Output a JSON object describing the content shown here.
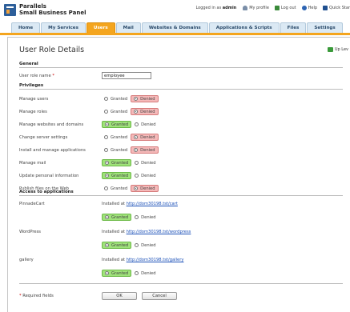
{
  "brand": {
    "line1": "Parallels",
    "line2": "Small Business Panel"
  },
  "header": {
    "login_prefix": "Logged in as",
    "login_user": "admin",
    "my_profile": "My profile",
    "log_out": "Log out",
    "help": "Help",
    "quick_start": "Quick Star"
  },
  "tabs": [
    "Home",
    "My Services",
    "Users",
    "Mail",
    "Websites & Domains",
    "Applications & Scripts",
    "Files",
    "Settings"
  ],
  "active_tab": "Users",
  "page": {
    "title": "User Role Details",
    "up_level": "Up Lev"
  },
  "general": {
    "heading": "General",
    "role_label": "User role name",
    "required_mark": "*",
    "role_value": "employee"
  },
  "privileges": {
    "heading": "Privileges",
    "granted_label": "Granted",
    "denied_label": "Denied",
    "items": [
      {
        "label": "Manage users",
        "state": "denied"
      },
      {
        "label": "Manage roles",
        "state": "denied"
      },
      {
        "label": "Manage websites and domains",
        "state": "granted"
      },
      {
        "label": "Change server settings",
        "state": "denied"
      },
      {
        "label": "Install and manage applications",
        "state": "denied"
      },
      {
        "label": "Manage mail",
        "state": "granted"
      },
      {
        "label": "Update personal information",
        "state": "granted"
      },
      {
        "label": "Publish files on the Web",
        "state": "denied"
      }
    ]
  },
  "applications": {
    "heading": "Access to applications",
    "installed_prefix": "Installed at",
    "items": [
      {
        "name": "PinnadeCart",
        "url": "http://dom30198.tst/cart",
        "state": "granted"
      },
      {
        "name": "WordPress",
        "url": "http://dom30198.tst/wordpress",
        "state": "granted"
      },
      {
        "name": "gallery",
        "url": "http://dom30198.tst/gallery",
        "state": "granted"
      }
    ]
  },
  "footer": {
    "required_note": "Required fields",
    "ok": "OK",
    "cancel": "Cancel"
  },
  "colors": {
    "accent": "#f4a51e",
    "granted": "#9fe27a",
    "denied": "#f5b9b9",
    "link": "#1a4fb8"
  }
}
